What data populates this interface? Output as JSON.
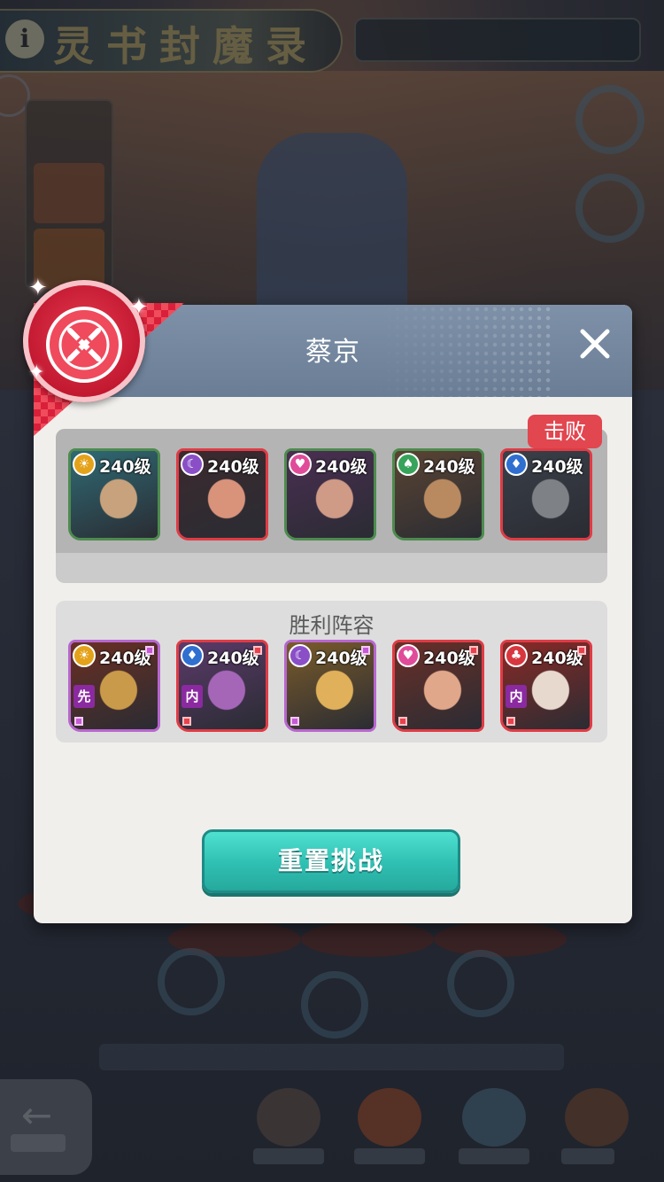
{
  "background": {
    "title": "灵书封魔录",
    "info_icon": "info-icon"
  },
  "dialog": {
    "title": "蔡京",
    "close_icon": "close-icon",
    "defeat_tag": "击败",
    "victory_lineup_label": "胜利阵容",
    "reset_button": "重置挑战"
  },
  "enemy_lineup": [
    {
      "level": "240级",
      "element": "sun",
      "element_color": "#e4a21a",
      "frame": "green",
      "portrait_colors": [
        "#2f6a74",
        "#c7a27c"
      ]
    },
    {
      "level": "240级",
      "element": "moon",
      "element_color": "#8a4fc7",
      "frame": "red",
      "portrait_colors": [
        "#3b2a2e",
        "#d9937b"
      ]
    },
    {
      "level": "240级",
      "element": "heart",
      "element_color": "#e04c9a",
      "frame": "green",
      "portrait_colors": [
        "#4a2e52",
        "#cf9a86"
      ]
    },
    {
      "level": "240级",
      "element": "spade",
      "element_color": "#38a35a",
      "frame": "green",
      "portrait_colors": [
        "#5a4433",
        "#b98a60"
      ]
    },
    {
      "level": "240级",
      "element": "diamond",
      "element_color": "#2f6fd0",
      "frame": "red",
      "portrait_colors": [
        "#3a3f48",
        "#7e8186"
      ]
    }
  ],
  "victory_lineup": [
    {
      "level": "240级",
      "element": "sun",
      "element_color": "#e4a21a",
      "frame": "purple",
      "role": "先",
      "portrait_colors": [
        "#6a2f22",
        "#c99a4a"
      ]
    },
    {
      "level": "240级",
      "element": "diamond",
      "element_color": "#2f6fd0",
      "frame": "red",
      "role": "内",
      "portrait_colors": [
        "#5b3a6a",
        "#a566b8"
      ]
    },
    {
      "level": "240级",
      "element": "moon",
      "element_color": "#8a4fc7",
      "frame": "purple",
      "role": "",
      "portrait_colors": [
        "#7a5b2a",
        "#e0b15a"
      ]
    },
    {
      "level": "240级",
      "element": "heart",
      "element_color": "#e04c9a",
      "frame": "red",
      "role": "",
      "portrait_colors": [
        "#6a2f28",
        "#e0a78a"
      ]
    },
    {
      "level": "240级",
      "element": "club",
      "element_color": "#d8373f",
      "frame": "red",
      "role": "内",
      "portrait_colors": [
        "#8a2a26",
        "#e8d9cf"
      ]
    }
  ],
  "colors": {
    "header": "#7a8da4",
    "dialog_bg": "#f1efec",
    "accent_teal": "#2fbfb2",
    "defeat_red": "#e2464f"
  }
}
